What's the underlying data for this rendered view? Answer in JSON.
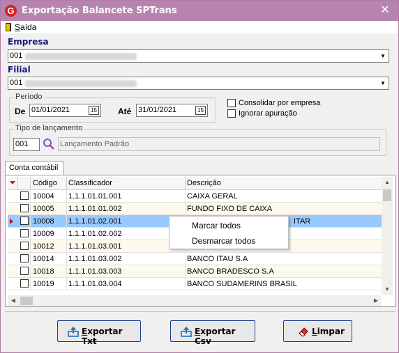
{
  "window": {
    "title": "Exportação Balancete SPTrans",
    "close_glyph": "✕",
    "app_icon_letter": "G"
  },
  "menu": {
    "exit_underlined": "S",
    "exit_rest": "aída",
    "exit_icon": "door-exit-icon"
  },
  "empresa": {
    "label": "Empresa",
    "value": "001"
  },
  "filial": {
    "label": "Filial",
    "value": "001"
  },
  "periodo": {
    "legend": "Período",
    "from_label": "De",
    "from_value": "01/01/2021",
    "to_label": "Até",
    "to_value": "31/01/2021",
    "calendar_glyph": "15"
  },
  "options": {
    "consolidar": "Consolidar por empresa",
    "ignorar": "Ignorar apuração"
  },
  "tipo": {
    "legend": "Tipo de lançamento",
    "code": "001",
    "description": "Lançamento Padrão"
  },
  "tab": {
    "label": "Conta contábil"
  },
  "grid": {
    "columns": [
      "Código",
      "Classificador",
      "Descrição"
    ],
    "rows": [
      {
        "code": "10004",
        "class": "1.1.1.01.01.001",
        "desc": "CAIXA GERAL"
      },
      {
        "code": "10005",
        "class": "1.1.1.01.01.002",
        "desc": "FUNDO FIXO DE CAIXA"
      },
      {
        "code": "10008",
        "class": "1.1.1.01.02.001",
        "desc": "ITAR"
      },
      {
        "code": "10009",
        "class": "1.1.1.01.02.002",
        "desc": ""
      },
      {
        "code": "10012",
        "class": "1.1.1.01.03.001",
        "desc": ""
      },
      {
        "code": "10014",
        "class": "1.1.1.01.03.002",
        "desc": "BANCO ITAU  S.A"
      },
      {
        "code": "10018",
        "class": "1.1.1.01.03.003",
        "desc": "BANCO BRADESCO  S.A"
      },
      {
        "code": "10019",
        "class": "1.1.1.01.03.004",
        "desc": "BANCO SUDAMERINS BRASIL"
      }
    ]
  },
  "context_menu": {
    "items": [
      "Marcar todos",
      "Desmarcar todos"
    ]
  },
  "buttons": {
    "txt": {
      "underlined": "E",
      "rest": "xportar Txt"
    },
    "csv": {
      "underlined": "E",
      "rest": "xportar Csv"
    },
    "limpar": {
      "underlined": "L",
      "rest": "impar"
    }
  },
  "colors": {
    "titlebar": "#b784b0",
    "selection": "#99c9ff",
    "label_blue": "#1a1a7a"
  }
}
